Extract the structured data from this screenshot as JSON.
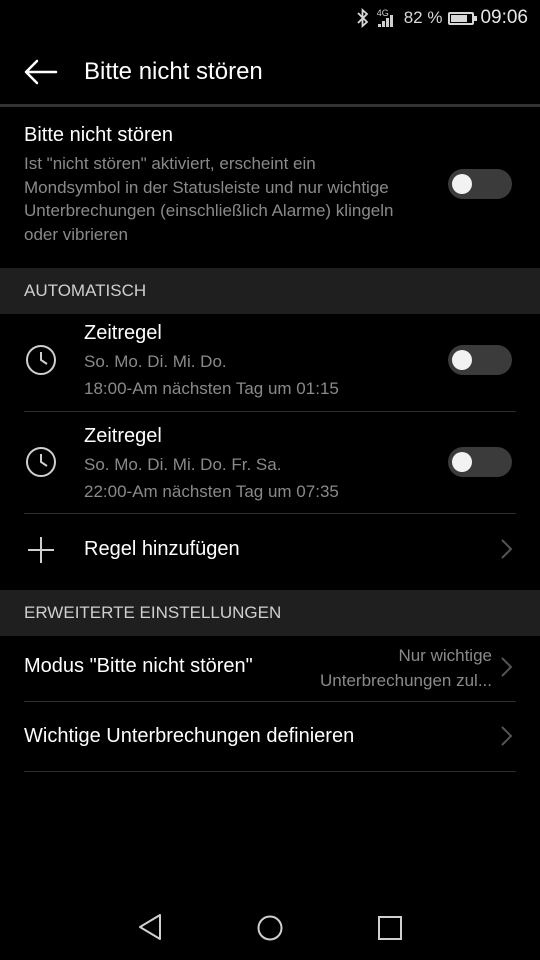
{
  "status_bar": {
    "network_label": "4G",
    "battery_text": "82 %",
    "battery_level": 0.82,
    "time": "09:06",
    "icons": [
      "bluetooth-icon",
      "signal-icon",
      "battery-icon"
    ]
  },
  "app_bar": {
    "title": "Bitte nicht stören",
    "back_icon": "arrow-left-icon"
  },
  "dnd": {
    "title": "Bitte nicht stören",
    "description": "Ist \"nicht stören\" aktiviert, erscheint ein Mondsymbol in der Statusleiste und nur wichtige Unterbrechungen (einschließlich Alarme) klingeln oder vibrieren",
    "enabled": false
  },
  "automatic": {
    "header": "AUTOMATISCH",
    "rules": [
      {
        "title": "Zeitregel",
        "days": "So. Mo. Di. Mi. Do.",
        "time": "18:00-Am nächsten Tag um 01:15",
        "enabled": false
      },
      {
        "title": "Zeitregel",
        "days": "So. Mo. Di. Mi. Do. Fr. Sa.",
        "time": "22:00-Am nächsten Tag um 07:35",
        "enabled": false
      }
    ],
    "add_rule_label": "Regel hinzufügen"
  },
  "advanced": {
    "header": "ERWEITERTE EINSTELLUNGEN",
    "mode_label": "Modus \"Bitte nicht stören\"",
    "mode_value_line1": "Nur wichtige",
    "mode_value_line2": "Unterbrechungen zul...",
    "important_label": "Wichtige Unterbrechungen definieren"
  },
  "colors": {
    "background": "#000000",
    "section_header_bg": "#1f1f1f",
    "secondary_text": "#8a8a8a",
    "toggle_off": "#3b3b3b"
  }
}
